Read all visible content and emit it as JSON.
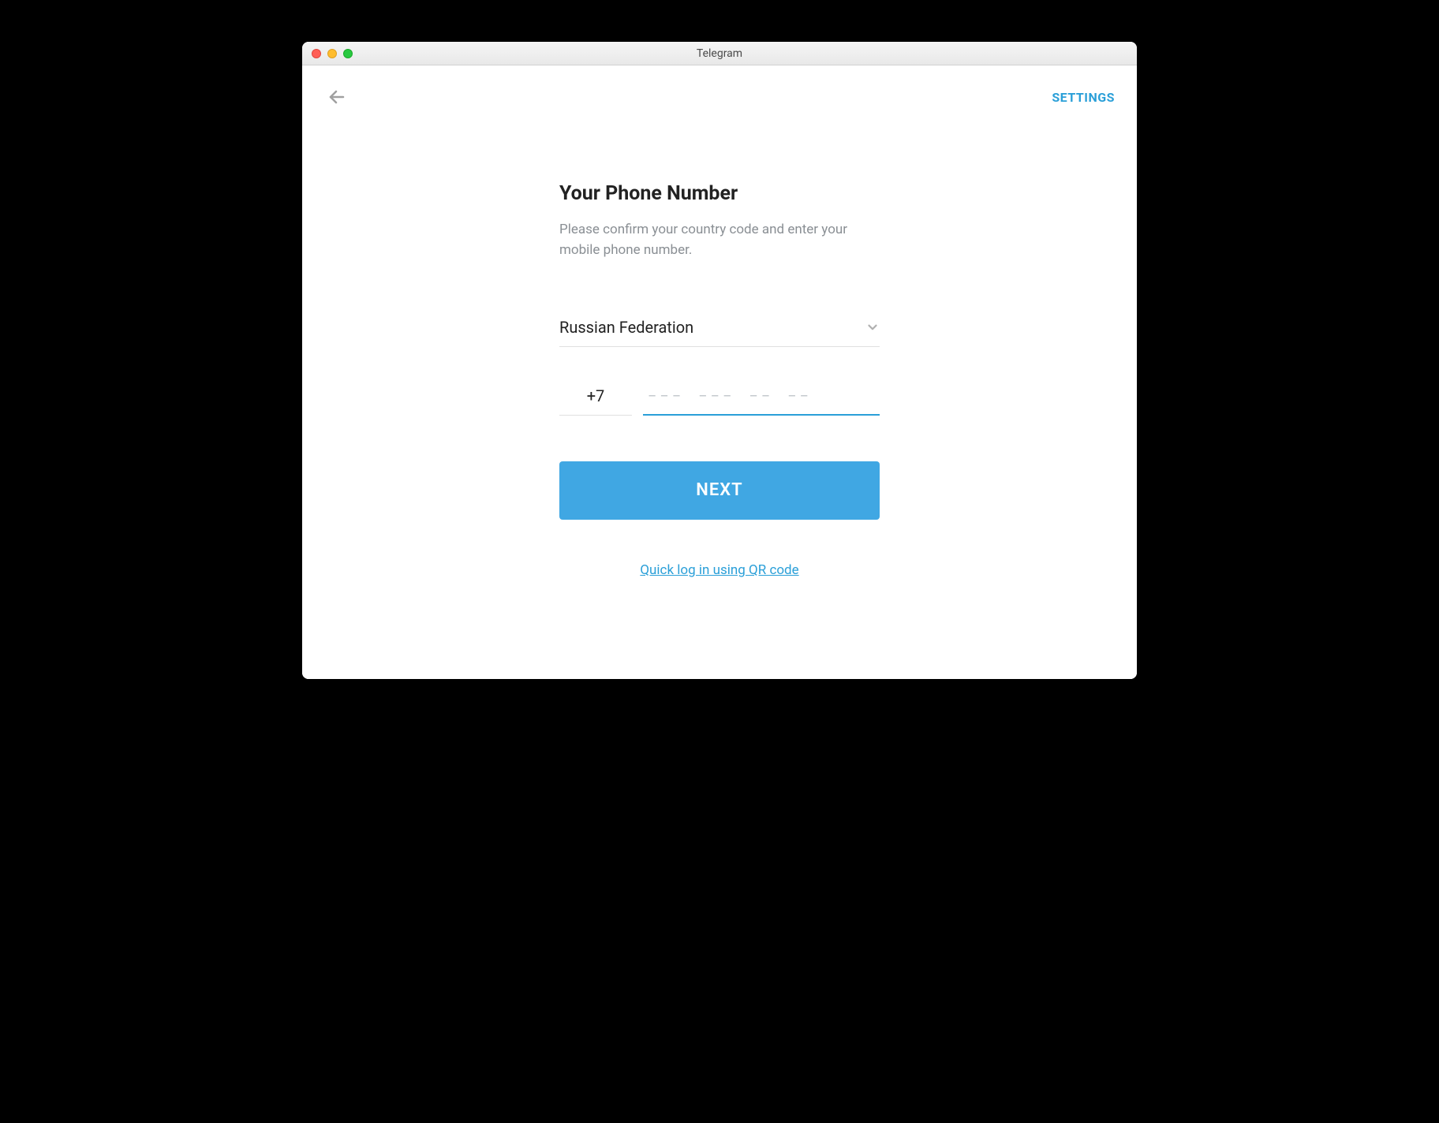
{
  "window": {
    "title": "Telegram"
  },
  "topbar": {
    "settings_label": "SETTINGS"
  },
  "form": {
    "heading": "Your Phone Number",
    "subtext": "Please confirm your country code and enter your mobile phone number.",
    "country_selected": "Russian Federation",
    "code_value": "+7",
    "phone_value": "",
    "phone_placeholder": "−−−  −−−  −−  −−",
    "next_label": "NEXT",
    "qr_link_label": "Quick log in using QR code"
  },
  "colors": {
    "accent": "#2a9fd8",
    "button": "#40a7e3"
  }
}
